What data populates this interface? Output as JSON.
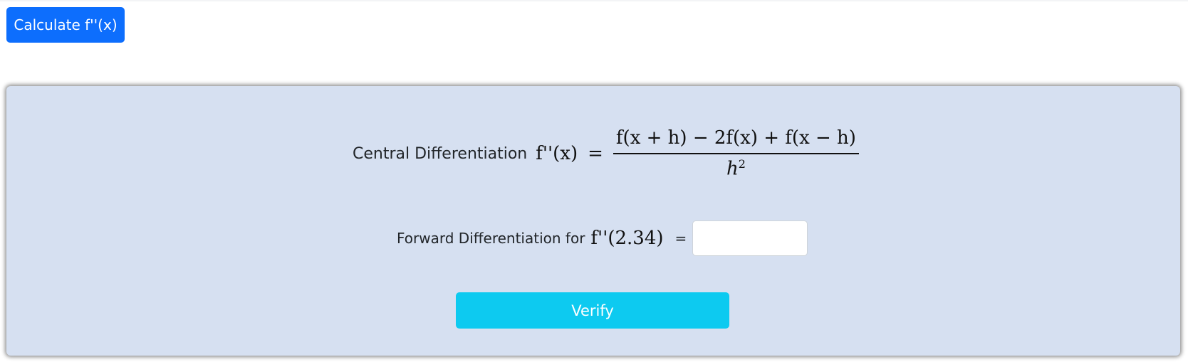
{
  "toolbar": {
    "calculate_label": "Calculate f''(x)",
    "calculate_color": "#0d6efd"
  },
  "panel": {
    "background": "#d6e0f1",
    "central": {
      "label": "Central Differentiation",
      "lhs": "f''(x)",
      "equals": "=",
      "numerator": "f(x + h) − 2f(x) + f(x − h)",
      "denominator_base": "h",
      "denominator_exponent": "2"
    },
    "forward": {
      "label": "Forward Differentiation for",
      "expression": "f''(2.34)",
      "equals": "=",
      "input_value": "",
      "input_placeholder": ""
    },
    "verify_label": "Verify",
    "verify_color": "#0dcaf0"
  }
}
